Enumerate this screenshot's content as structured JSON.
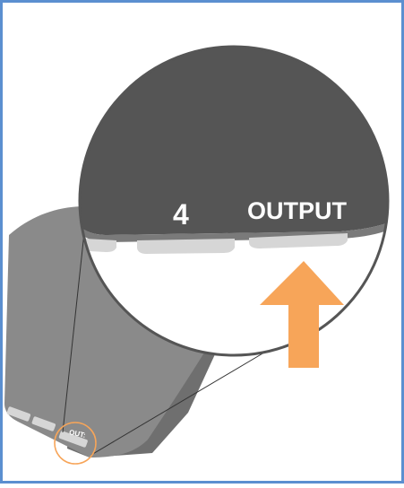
{
  "illustration": {
    "frame_color": "#5b8fd0",
    "device_color": "#8a8a8a",
    "device_shadow_color": "#6f6f6f",
    "magnifier_dark_color": "#555555",
    "port_color": "#d6d6d6",
    "arrow_color": "#f7a559",
    "small_label": "OUT:",
    "zoom_port_number": "4",
    "zoom_port_label": "OUTPUT",
    "icons": [
      "magnifier-circle",
      "up-arrow"
    ]
  }
}
